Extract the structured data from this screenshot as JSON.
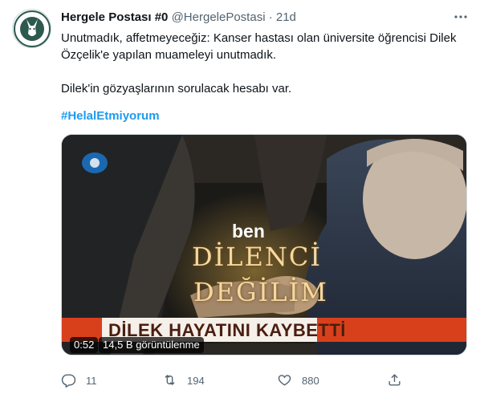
{
  "tweet": {
    "author_name": "Hergele Postası #0",
    "author_handle": "@HergelePostasi",
    "separator": "·",
    "time_ago": "21d",
    "text_line1": "Unutmadık, affetmeyeceğiz: Kanser hastası olan üniversite öğrencisi Dilek",
    "text_line2": "Özçelik'e yapılan muameleyi unutmadık.",
    "text_line3": "Dilek'in gözyaşlarının sorulacak hesabı var.",
    "hashtag": "#HelalEtmiyorum"
  },
  "media": {
    "overlay_ben": "ben",
    "overlay_dilenci": "DİLENCİ",
    "overlay_degilim": "DEĞİLİM",
    "banner_text": "DİLEK HAYATINI KAYBETTİ",
    "duration": "0:52",
    "views": "14,5 B görüntülenme"
  },
  "actions": {
    "reply_count": "11",
    "retweet_count": "194",
    "like_count": "880"
  },
  "icons": {
    "more": "more-icon",
    "reply": "reply-icon",
    "retweet": "retweet-icon",
    "like": "like-icon",
    "share": "share-icon"
  },
  "colors": {
    "text": "#0f1419",
    "secondary": "#536471",
    "link": "#1d9bf0",
    "banner": "#d8401c"
  }
}
